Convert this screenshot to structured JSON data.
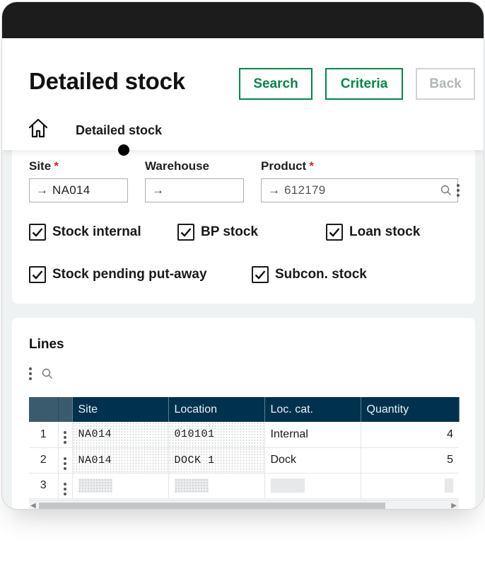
{
  "header": {
    "title": "Detailed stock",
    "buttons": {
      "search": "Search",
      "criteria": "Criteria",
      "back": "Back"
    },
    "breadcrumb": "Detailed stock"
  },
  "criteria": {
    "site": {
      "label": "Site",
      "required_mark": "*",
      "value": "NA014"
    },
    "warehouse": {
      "label": "Warehouse",
      "value": ""
    },
    "product": {
      "label": "Product",
      "required_mark": "*",
      "value": "612179"
    },
    "checkboxes": [
      {
        "label": "Stock internal",
        "checked": true
      },
      {
        "label": "BP stock",
        "checked": true
      },
      {
        "label": "Loan stock",
        "checked": true
      },
      {
        "label": "Stock pending put-away",
        "checked": true
      },
      {
        "label": "Subcon. stock",
        "checked": true
      }
    ]
  },
  "lines": {
    "title": "Lines",
    "columns": [
      "Site",
      "Location",
      "Loc. cat.",
      "Quantity"
    ],
    "rows": [
      {
        "num": "1",
        "site": "NA014",
        "location": "010101",
        "loc_cat": "Internal",
        "quantity": "4"
      },
      {
        "num": "2",
        "site": "NA014",
        "location": "DOCK 1",
        "loc_cat": "Dock",
        "quantity": "5"
      },
      {
        "num": "3",
        "site": "",
        "location": "",
        "loc_cat": "",
        "quantity": ""
      }
    ]
  },
  "icons": {
    "home": "home-icon",
    "field_arrow": "arrow-right-icon",
    "search": "search-icon",
    "more": "kebab-menu-icon",
    "check": "checkmark-icon"
  },
  "colors": {
    "accent": "#00884a",
    "grid_header": "#00324e",
    "required": "#d02a2a",
    "disabled": "#b3b7b9"
  }
}
